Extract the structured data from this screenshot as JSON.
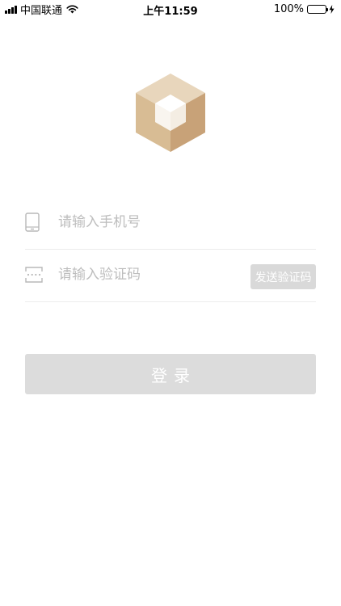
{
  "status_bar": {
    "carrier": "中国联通",
    "time": "上午11:59",
    "battery": "100%",
    "battery_color": "#4cd964"
  },
  "logo": {
    "icon": "cube-logo-icon",
    "colors": [
      "#e8d6bc",
      "#d8bc94",
      "#c8a278",
      "#f4ede3"
    ]
  },
  "form": {
    "phone": {
      "icon": "phone-icon",
      "placeholder": "请输入手机号",
      "value": ""
    },
    "code": {
      "icon": "verification-code-icon",
      "placeholder": "请输入验证码",
      "value": "",
      "send_label": "发送验证码"
    }
  },
  "login_button": {
    "label": "登录"
  }
}
